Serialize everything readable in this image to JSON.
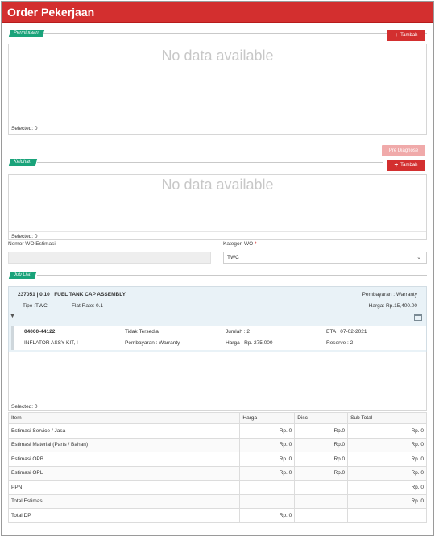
{
  "header": {
    "title": "Order Pekerjaan"
  },
  "permintaan": {
    "tag": "Permintaan",
    "add_label": "Tambah",
    "empty_text": "No data available",
    "selected_text": "Selected: 0"
  },
  "keluhan": {
    "tag": "Keluhan",
    "prediagnose_label": "Pre Diagnose",
    "add_label": "Tambah",
    "empty_text": "No data available",
    "selected_text": "Selected: 0"
  },
  "form": {
    "nomor_label": "Nomor WO Estimasi",
    "nomor_value": "",
    "kategori_label": "Kategori WO",
    "kategori_required": "*",
    "kategori_value": "TWC"
  },
  "joblist": {
    "tag": "Job List",
    "job": {
      "title": "237051 | 0.10 | FUEL TANK CAP ASSEMBLY",
      "pembayaran": "Pembayaran : Warranty",
      "tipe": "Tipe :TWC",
      "flat_rate": "Flat Rate: 0.1",
      "harga": "Harga: Rp.15,400.00"
    },
    "part": {
      "code": "04000-44122",
      "name": "INFLATOR ASSY KIT, I",
      "availability": "Tidak Tersedia",
      "pembayaran": "Pembayaran : Warranty",
      "jumlah": "Jumlah : 2",
      "harga": "Harga : Rp. 275,000",
      "eta": "ETA : 07-02-2021",
      "reserve": "Reserve : 2"
    },
    "selected_text": "Selected: 0"
  },
  "estimasi": {
    "headers": [
      "Item",
      "Harga",
      "Disc",
      "Sub Total"
    ],
    "rows": [
      [
        "Estimasi Service / Jasa",
        "Rp. 0",
        "Rp.0",
        "Rp. 0"
      ],
      [
        "Estimasi Material (Parts / Bahan)",
        "Rp. 0",
        "Rp.0",
        "Rp. 0"
      ],
      [
        "Estimasi OPB",
        "Rp. 0",
        "Rp.0",
        "Rp. 0"
      ],
      [
        "Estimasi OPL",
        "Rp. 0",
        "Rp.0",
        "Rp. 0"
      ],
      [
        "PPN",
        "",
        "",
        "Rp. 0"
      ],
      [
        "Total Estimasi",
        "",
        "",
        "Rp. 0"
      ],
      [
        "Total DP",
        "Rp. 0",
        "",
        ""
      ]
    ]
  },
  "icons": {
    "add": "plus-icon",
    "caret": "caret-down-icon",
    "calendar": "calendar-icon",
    "chevron": "chevron-down-icon"
  },
  "colors": {
    "header": "#d32f2f",
    "tag": "#1aa37a",
    "job_panel": "#e9f2f7"
  }
}
